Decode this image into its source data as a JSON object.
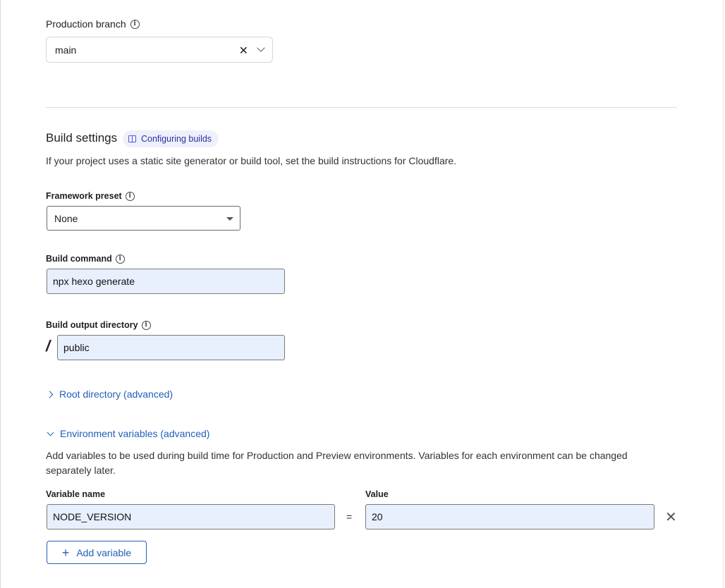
{
  "production_branch": {
    "label": "Production branch",
    "value": "main",
    "clear_glyph": "✕"
  },
  "build_settings": {
    "title": "Build settings",
    "docs_link": "Configuring builds",
    "description": "If your project uses a static site generator or build tool, set the build instructions for Cloudflare."
  },
  "framework_preset": {
    "label": "Framework preset",
    "value": "None"
  },
  "build_command": {
    "label": "Build command",
    "value": "npx hexo generate"
  },
  "build_output": {
    "label": "Build output directory",
    "prefix": "/",
    "value": "public"
  },
  "root_directory": {
    "label": "Root directory (advanced)"
  },
  "env_vars": {
    "label": "Environment variables (advanced)",
    "description": "Add variables to be used during build time for Production and Preview environments. Variables for each environment can be changed separately later.",
    "name_header": "Variable name",
    "value_header": "Value",
    "rows": [
      {
        "name": "NODE_VERSION",
        "equals": "=",
        "value": "20",
        "remove_glyph": "✕"
      }
    ],
    "add_button": "Add variable",
    "add_glyph": "+"
  },
  "colors": {
    "link": "#2160b8",
    "input_fill": "#e8f0fe",
    "pill_bg": "#eef0fb"
  },
  "icons": {
    "info": "info-circle-icon",
    "book": "book-icon",
    "chevron_right": "chevron-right-icon",
    "chevron_down": "chevron-down-icon"
  }
}
